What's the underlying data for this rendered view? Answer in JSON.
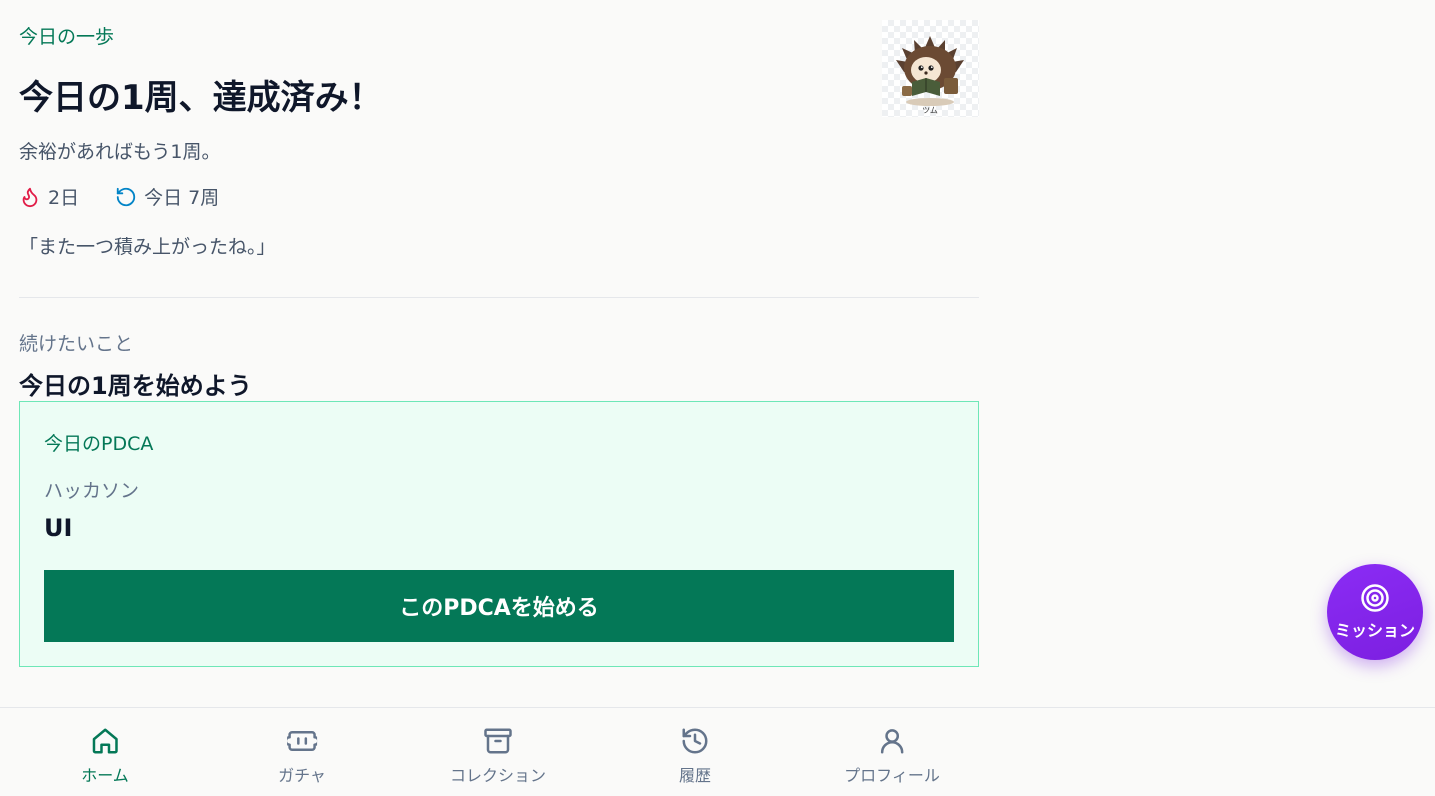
{
  "hero": {
    "kicker": "今日の一歩",
    "title": "今日の1周、達成済み！",
    "subtext": "余裕があればもう1周。",
    "avatar_icon": "hedgehog-character-icon",
    "avatar_caption": "ツム"
  },
  "stats": {
    "streak_icon": "flame-icon",
    "streak": "2日",
    "laps_icon": "refresh-icon",
    "laps": "今日 7周"
  },
  "quote": "「また一つ積み上がったね。」",
  "section": {
    "label": "続けたいこと",
    "title": "今日の1周を始めよう"
  },
  "card": {
    "kicker": "今日のPDCA",
    "category": "ハッカソン",
    "item": "UI",
    "button_label": "このPDCAを始める"
  },
  "fab": {
    "icon": "target-icon",
    "label": "ミッション"
  },
  "nav": {
    "items": [
      {
        "label": "ホーム",
        "icon": "home-icon",
        "active": true
      },
      {
        "label": "ガチャ",
        "icon": "ticket-icon",
        "active": false
      },
      {
        "label": "コレクション",
        "icon": "archive-icon",
        "active": false
      },
      {
        "label": "履歴",
        "icon": "history-icon",
        "active": false
      },
      {
        "label": "プロフィール",
        "icon": "user-icon",
        "active": false
      }
    ]
  },
  "colors": {
    "accent": "#047857",
    "background": "#fafaf9",
    "card_bg": "#ecfdf5",
    "card_border": "#6ee7b7",
    "fab": "#7e22ce",
    "flame": "#e11d48",
    "laps": "#0284c7"
  }
}
